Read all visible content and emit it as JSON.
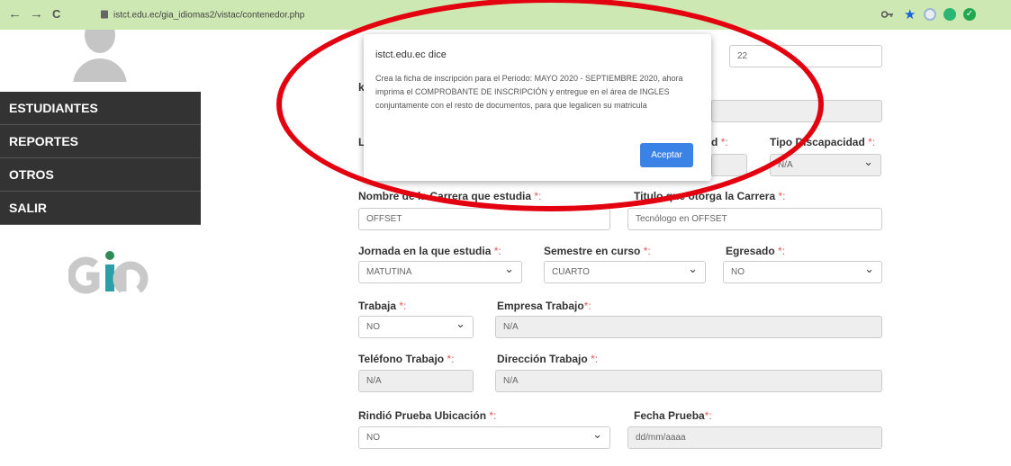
{
  "browser": {
    "url": "istct.edu.ec/gia_idiomas2/vistac/contenedor.php",
    "back_icon": "←",
    "forward_icon": "→",
    "reload_icon": "C"
  },
  "sidebar": {
    "items": [
      {
        "label": "ESTUDIANTES"
      },
      {
        "label": "REPORTES"
      },
      {
        "label": "OTROS"
      },
      {
        "label": "SALIR"
      }
    ]
  },
  "dialog": {
    "title": "istct.edu.ec dice",
    "message": "Crea la ficha de inscripción para el Periodo: MAYO 2020 - SEPTIEMBRE 2020, ahora imprima el COMPROBANTE DE INSCRIPCIÓN y entregue en el área de INGLES conjuntamente con el resto de documentos, para que legalicen su matricula",
    "button": "Aceptar"
  },
  "form": {
    "required_mark": "*:",
    "required_mark_alt": "*:",
    "partial_field_top_value": "22",
    "partial_label_d": "d",
    "partial_label_k": "k",
    "partial_label_L": "L",
    "tipo_discapacidad": {
      "label": "Tipo Discapacidad",
      "value": "N/A"
    },
    "carrera": {
      "label": "Nombre de la Carrera que estudia",
      "value": "OFFSET"
    },
    "titulo": {
      "label": "Titulo que otorga la Carrera",
      "value": "Tecnólogo en OFFSET"
    },
    "jornada": {
      "label": "Jornada en la que estudia",
      "value": "MATUTINA"
    },
    "semestre": {
      "label": "Semestre en curso",
      "value": "CUARTO"
    },
    "egresado": {
      "label": "Egresado",
      "value": "NO"
    },
    "trabaja": {
      "label": "Trabaja",
      "value": "NO"
    },
    "empresa": {
      "label": "Empresa Trabajo",
      "value": "N/A"
    },
    "telefono": {
      "label": "Teléfono Trabajo",
      "value": "N/A"
    },
    "direccion": {
      "label": "Dirección Trabajo",
      "value": "N/A"
    },
    "prueba": {
      "label": "Rindió Prueba Ubicación",
      "value": "NO"
    },
    "fecha_prueba": {
      "label": "Fecha Prueba",
      "placeholder": "dd/mm/aaaa"
    }
  },
  "colors": {
    "annotation_ring": "#e3000f",
    "sidebar_bg": "#333333",
    "toolbar_bg": "#cde8b2",
    "accept_button": "#3b82e6"
  }
}
